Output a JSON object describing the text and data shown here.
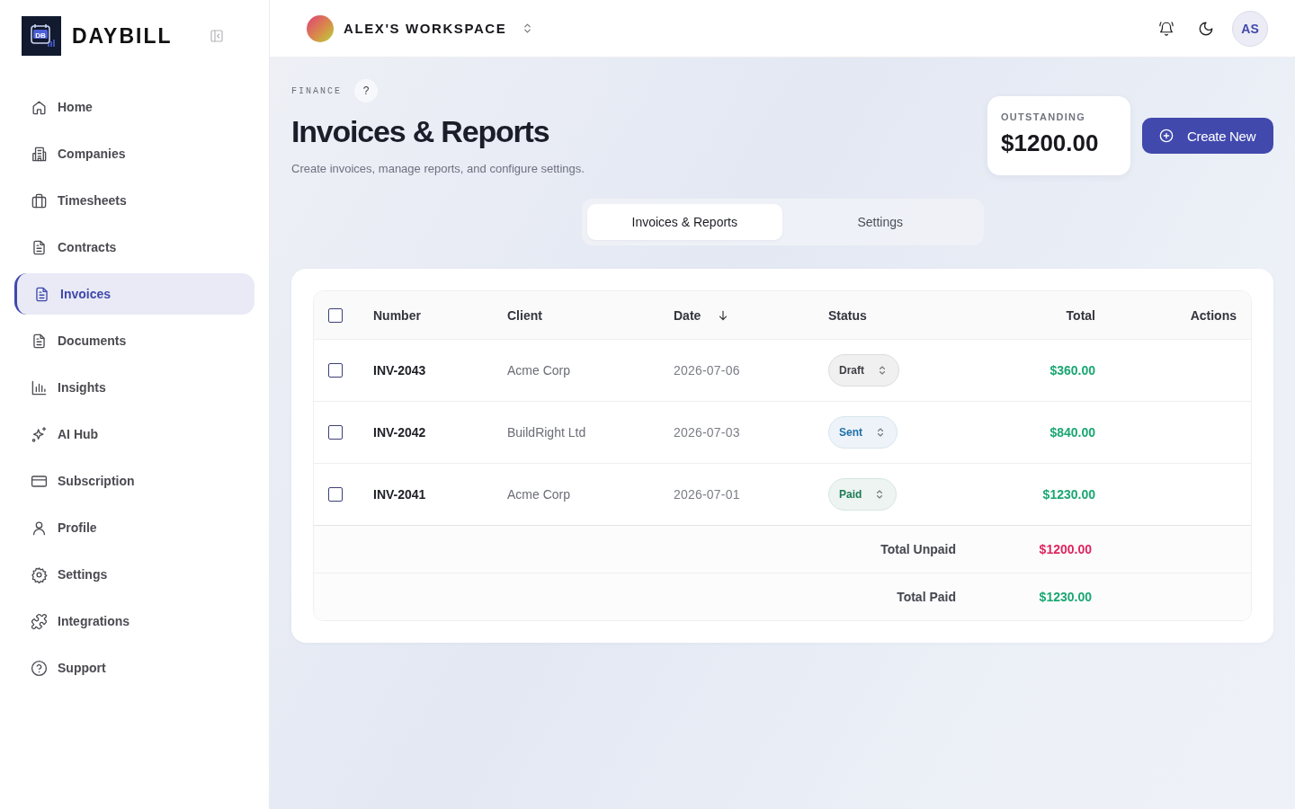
{
  "app": {
    "logo_mark": "DB",
    "name": "DAYBILL"
  },
  "sidebar": {
    "items": [
      {
        "label": "Home",
        "selected": false
      },
      {
        "label": "Companies",
        "selected": false
      },
      {
        "label": "Timesheets",
        "selected": false
      },
      {
        "label": "Contracts",
        "selected": false
      },
      {
        "label": "Invoices",
        "selected": true
      },
      {
        "label": "Documents",
        "selected": false
      },
      {
        "label": "Insights",
        "selected": false
      },
      {
        "label": "AI Hub",
        "selected": false
      },
      {
        "label": "Subscription",
        "selected": false
      },
      {
        "label": "Profile",
        "selected": false
      },
      {
        "label": "Settings",
        "selected": false
      },
      {
        "label": "Integrations",
        "selected": false
      },
      {
        "label": "Support",
        "selected": false
      }
    ]
  },
  "topbar": {
    "workspace": "ALEX'S WORKSPACE",
    "avatar_initials": "AS"
  },
  "page": {
    "eyebrow": "FINANCE",
    "help": "?",
    "title": "Invoices & Reports",
    "subtitle": "Create invoices, manage reports, and configure settings."
  },
  "outstanding": {
    "label": "OUTSTANDING",
    "amount": "$1200.00"
  },
  "create_button": "Create New",
  "tabs": [
    {
      "label": "Invoices & Reports",
      "selected": true
    },
    {
      "label": "Settings",
      "selected": false
    }
  ],
  "table": {
    "select_all_checked": false,
    "columns": [
      "Number",
      "Client",
      "Date",
      "Status",
      "Total",
      "Actions"
    ],
    "rows": [
      {
        "checked": false,
        "number": "INV-2043",
        "client": "Acme Corp",
        "date": "2026-07-06",
        "status": {
          "label": "Draft",
          "color": "#3f3f46"
        },
        "total": "$360.00"
      },
      {
        "checked": false,
        "number": "INV-2042",
        "client": "BuildRight Ltd",
        "date": "2026-07-03",
        "status": {
          "label": "Sent",
          "color": "#1f6fa8"
        },
        "total": "$840.00"
      },
      {
        "checked": false,
        "number": "INV-2041",
        "client": "Acme Corp",
        "date": "2026-07-01",
        "status": {
          "label": "Paid",
          "color": "#1d7a55"
        },
        "total": "$1230.00"
      }
    ],
    "totals": [
      {
        "label": "Total Unpaid",
        "amount": "$1200.00",
        "color": "#e0245e"
      },
      {
        "label": "Total Paid",
        "amount": "$1230.00",
        "color": "#1aa772"
      }
    ]
  }
}
